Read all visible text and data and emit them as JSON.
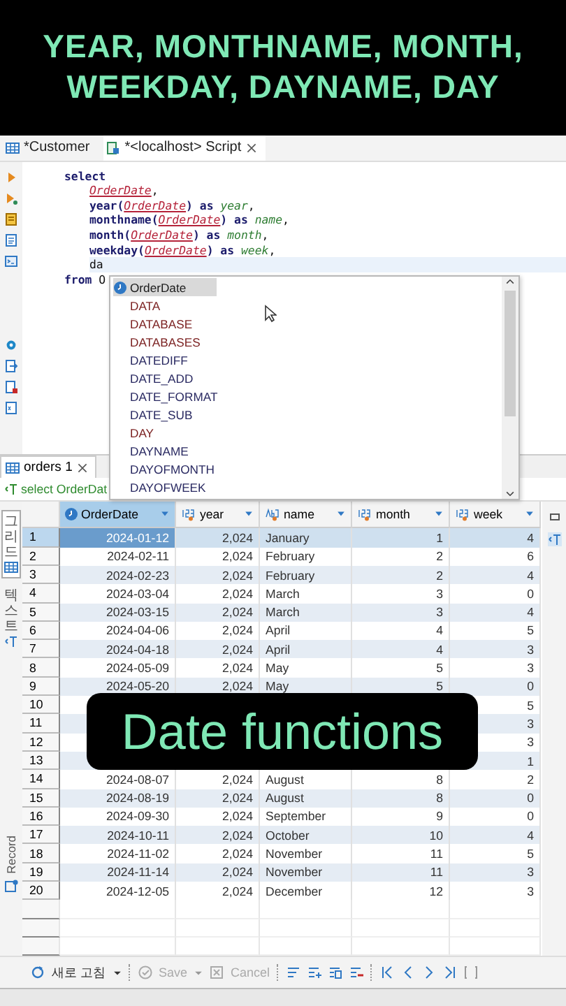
{
  "banner": {
    "lines": [
      "YEAR, MONTHNAME, MONTH,",
      "WEEKDAY, DAYNAME, DAY"
    ]
  },
  "editor_tabs": [
    {
      "label": "*Customer",
      "selected": false,
      "kind": "table"
    },
    {
      "label": "*<localhost> Script",
      "selected": true,
      "kind": "script"
    }
  ],
  "editor": {
    "lines": [
      {
        "current": false,
        "segments": [
          {
            "kind": "keyword",
            "text": "select"
          }
        ]
      },
      {
        "current": false,
        "segments": [
          {
            "kind": "column",
            "text": "OrderDate"
          },
          {
            "kind": "plain",
            "text": ","
          }
        ]
      },
      {
        "current": false,
        "segments": [
          {
            "kind": "keyword",
            "text": "year("
          },
          {
            "kind": "column",
            "text": "OrderDate"
          },
          {
            "kind": "keyword",
            "text": ") as "
          },
          {
            "kind": "alias",
            "text": "year"
          },
          {
            "kind": "plain",
            "text": ","
          }
        ]
      },
      {
        "current": false,
        "segments": [
          {
            "kind": "keyword",
            "text": "monthname("
          },
          {
            "kind": "column",
            "text": "OrderDate"
          },
          {
            "kind": "keyword",
            "text": ") as "
          },
          {
            "kind": "alias",
            "text": "name"
          },
          {
            "kind": "plain",
            "text": ","
          }
        ]
      },
      {
        "current": false,
        "segments": [
          {
            "kind": "keyword",
            "text": "month("
          },
          {
            "kind": "column",
            "text": "OrderDate"
          },
          {
            "kind": "keyword",
            "text": ") as "
          },
          {
            "kind": "alias",
            "text": "month"
          },
          {
            "kind": "plain",
            "text": ","
          }
        ]
      },
      {
        "current": false,
        "segments": [
          {
            "kind": "keyword",
            "text": "weekday("
          },
          {
            "kind": "column",
            "text": "OrderDate"
          },
          {
            "kind": "keyword",
            "text": ") as "
          },
          {
            "kind": "alias",
            "text": "week"
          },
          {
            "kind": "plain",
            "text": ","
          }
        ]
      },
      {
        "current": true,
        "segments": [
          {
            "kind": "plain",
            "text": "da"
          }
        ]
      },
      {
        "current": false,
        "segments": [
          {
            "kind": "keyword",
            "text": "from "
          },
          {
            "kind": "plain",
            "text": "O"
          }
        ]
      }
    ]
  },
  "autocomplete": {
    "items": [
      {
        "label": "OrderDate",
        "kind": "column",
        "selected": true
      },
      {
        "label": "DATA",
        "kind": "keyword",
        "selected": false
      },
      {
        "label": "DATABASE",
        "kind": "keyword",
        "selected": false
      },
      {
        "label": "DATABASES",
        "kind": "keyword",
        "selected": false
      },
      {
        "label": "DATEDIFF",
        "kind": "function",
        "selected": false
      },
      {
        "label": "DATE_ADD",
        "kind": "function",
        "selected": false
      },
      {
        "label": "DATE_FORMAT",
        "kind": "function",
        "selected": false
      },
      {
        "label": "DATE_SUB",
        "kind": "function",
        "selected": false
      },
      {
        "label": "DAY",
        "kind": "keyword",
        "selected": false
      },
      {
        "label": "DAYNAME",
        "kind": "function",
        "selected": false
      },
      {
        "label": "DAYOFMONTH",
        "kind": "function",
        "selected": false
      },
      {
        "label": "DAYOFWEEK",
        "kind": "function",
        "selected": false
      }
    ]
  },
  "results": {
    "tab": "orders 1",
    "filter": "select OrderDat",
    "side_tabs": [
      {
        "label": "그리드",
        "selected": true
      },
      {
        "label": "텍스트",
        "selected": false
      }
    ],
    "record_label": "Record",
    "columns": [
      {
        "label": "OrderDate",
        "kind": "date"
      },
      {
        "label": "year",
        "kind": "number"
      },
      {
        "label": "name",
        "kind": "text"
      },
      {
        "label": "month",
        "kind": "number"
      },
      {
        "label": "week",
        "kind": "number"
      }
    ],
    "rows": [
      {
        "num": "1",
        "selected": true,
        "cells": [
          "2024-01-12",
          "2,024",
          "January",
          "1",
          "4"
        ]
      },
      {
        "num": "2",
        "selected": false,
        "cells": [
          "2024-02-11",
          "2,024",
          "February",
          "2",
          "6"
        ]
      },
      {
        "num": "3",
        "selected": false,
        "cells": [
          "2024-02-23",
          "2,024",
          "February",
          "2",
          "4"
        ]
      },
      {
        "num": "4",
        "selected": false,
        "cells": [
          "2024-03-04",
          "2,024",
          "March",
          "3",
          "0"
        ]
      },
      {
        "num": "5",
        "selected": false,
        "cells": [
          "2024-03-15",
          "2,024",
          "March",
          "3",
          "4"
        ]
      },
      {
        "num": "6",
        "selected": false,
        "cells": [
          "2024-04-06",
          "2,024",
          "April",
          "4",
          "5"
        ]
      },
      {
        "num": "7",
        "selected": false,
        "cells": [
          "2024-04-18",
          "2,024",
          "April",
          "4",
          "3"
        ]
      },
      {
        "num": "8",
        "selected": false,
        "cells": [
          "2024-05-09",
          "2,024",
          "May",
          "5",
          "3"
        ]
      },
      {
        "num": "9",
        "selected": false,
        "cells": [
          "2024-05-20",
          "2,024",
          "May",
          "5",
          "0"
        ]
      },
      {
        "num": "10",
        "selected": false,
        "cells": [
          null,
          null,
          null,
          null,
          "5"
        ]
      },
      {
        "num": "11",
        "selected": false,
        "cells": [
          null,
          null,
          null,
          null,
          "3"
        ]
      },
      {
        "num": "12",
        "selected": false,
        "cells": [
          null,
          null,
          null,
          null,
          "3"
        ]
      },
      {
        "num": "13",
        "selected": false,
        "cells": [
          null,
          null,
          null,
          null,
          "1"
        ]
      },
      {
        "num": "14",
        "selected": false,
        "cells": [
          "2024-08-07",
          "2,024",
          "August",
          "8",
          "2"
        ]
      },
      {
        "num": "15",
        "selected": false,
        "cells": [
          "2024-08-19",
          "2,024",
          "August",
          "8",
          "0"
        ]
      },
      {
        "num": "16",
        "selected": false,
        "cells": [
          "2024-09-30",
          "2,024",
          "September",
          "9",
          "0"
        ]
      },
      {
        "num": "17",
        "selected": false,
        "cells": [
          "2024-10-11",
          "2,024",
          "October",
          "10",
          "4"
        ]
      },
      {
        "num": "18",
        "selected": false,
        "cells": [
          "2024-11-02",
          "2,024",
          "November",
          "11",
          "5"
        ]
      },
      {
        "num": "19",
        "selected": false,
        "cells": [
          "2024-11-14",
          "2,024",
          "November",
          "11",
          "3"
        ]
      },
      {
        "num": "20",
        "selected": false,
        "cells": [
          "2024-12-05",
          "2,024",
          "December",
          "12",
          "3"
        ]
      }
    ],
    "toolbar": [
      {
        "label": "새로 고침",
        "disabled": false
      },
      {
        "label": "Save",
        "disabled": true
      },
      {
        "label": "Cancel",
        "disabled": true
      }
    ]
  },
  "caption": "Date functions"
}
